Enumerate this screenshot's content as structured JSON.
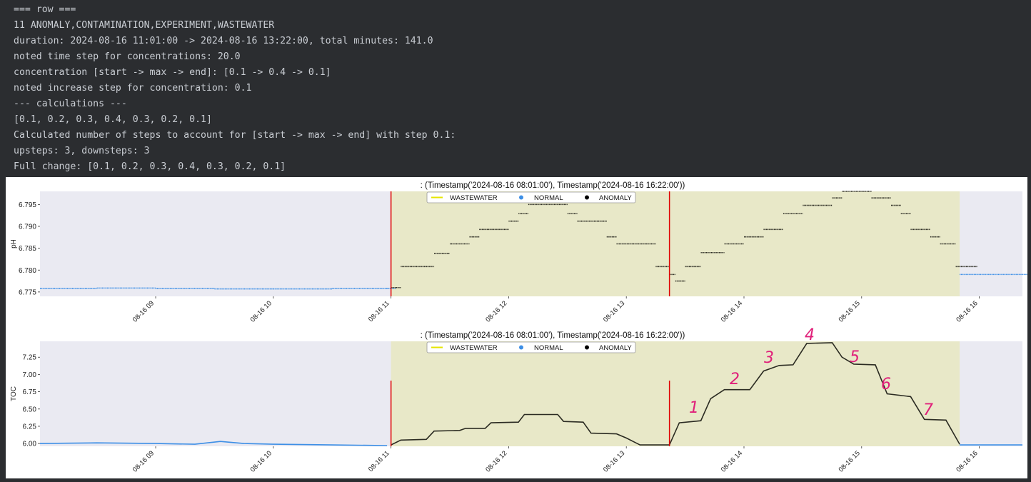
{
  "console": {
    "lines": [
      "=== row ===",
      "11 ANOMALY,CONTAMINATION,EXPERIMENT,WASTEWATER",
      "duration: 2024-08-16 11:01:00 -> 2024-08-16 13:22:00, total minutes: 141.0",
      "noted time step for concentrations: 20.0",
      "concentration [start -> max -> end]: [0.1 -> 0.4 -> 0.1]",
      "noted increase step for concentration: 0.1",
      "--- calculations ---",
      "[0.1, 0.2, 0.3, 0.4, 0.3, 0.2, 0.1]",
      "Calculated number of steps to account for [start -> max -> end] with step 0.1:",
      "upsteps: 3, downsteps: 3",
      "Full change: [0.1, 0.2, 0.3, 0.4, 0.3, 0.2, 0.1]"
    ]
  },
  "colors": {
    "console_bg": "#2b2d30",
    "console_text": "#c9cdd3",
    "plot_bg": "#eaeaf2",
    "wastewater_span": "#e8e8c8",
    "normal": "#3d8fe6",
    "anomaly": "#2b2b22",
    "event_line": "#e00000",
    "annotation": "#e0207a"
  },
  "legend": {
    "wastewater": "WASTEWATER",
    "normal": "NORMAL",
    "anomaly": "ANOMALY"
  },
  "chart_data": [
    {
      "type": "scatter",
      "title": ": (Timestamp('2024-08-16 08:01:00'), Timestamp('2024-08-16 16:22:00'))",
      "xlabel": "",
      "ylabel": "pH",
      "x_ticks": [
        "08-16 09",
        "08-16 10",
        "08-16 11",
        "08-16 12",
        "08-16 13",
        "08-16 14",
        "08-16 15",
        "08-16 16"
      ],
      "y_ticks": [
        "6.775",
        "6.780",
        "6.785",
        "6.790",
        "6.795"
      ],
      "xlim": [
        "2024-08-16 08:01",
        "2024-08-16 16:22"
      ],
      "ylim": [
        6.774,
        6.798
      ],
      "wastewater_span": [
        "2024-08-16 11:00",
        "2024-08-16 15:50"
      ],
      "event_lines": [
        "2024-08-16 11:00",
        "2024-08-16 13:22"
      ],
      "grid": false,
      "legend_position": "top-center",
      "series": [
        {
          "name": "NORMAL",
          "points": [
            [
              "2024-08-16 08:01",
              6.7758
            ],
            [
              "2024-08-16 08:30",
              6.7759
            ],
            [
              "2024-08-16 09:00",
              6.7758
            ],
            [
              "2024-08-16 09:30",
              6.7757
            ],
            [
              "2024-08-16 10:00",
              6.7757
            ],
            [
              "2024-08-16 10:30",
              6.7758
            ],
            [
              "2024-08-16 10:58",
              6.7758
            ],
            [
              "2024-08-16 15:50",
              6.779
            ],
            [
              "2024-08-16 16:05",
              6.779
            ],
            [
              "2024-08-16 16:22",
              6.779
            ]
          ]
        },
        {
          "name": "ANOMALY",
          "points": [
            [
              "2024-08-16 11:00",
              6.776
            ],
            [
              "2024-08-16 11:05",
              6.7808
            ],
            [
              "2024-08-16 11:18",
              6.7808
            ],
            [
              "2024-08-16 11:22",
              6.7838
            ],
            [
              "2024-08-16 11:30",
              6.786
            ],
            [
              "2024-08-16 11:40",
              6.7876
            ],
            [
              "2024-08-16 11:45",
              6.7893
            ],
            [
              "2024-08-16 11:55",
              6.7893
            ],
            [
              "2024-08-16 12:00",
              6.7912
            ],
            [
              "2024-08-16 12:05",
              6.7929
            ],
            [
              "2024-08-16 12:10",
              6.795
            ],
            [
              "2024-08-16 12:25",
              6.795
            ],
            [
              "2024-08-16 12:30",
              6.7929
            ],
            [
              "2024-08-16 12:35",
              6.7912
            ],
            [
              "2024-08-16 12:45",
              6.7912
            ],
            [
              "2024-08-16 12:50",
              6.7876
            ],
            [
              "2024-08-16 12:55",
              6.786
            ],
            [
              "2024-08-16 13:10",
              6.786
            ],
            [
              "2024-08-16 13:15",
              6.7808
            ],
            [
              "2024-08-16 13:22",
              6.779
            ],
            [
              "2024-08-16 13:25",
              6.7775
            ],
            [
              "2024-08-16 13:30",
              6.7808
            ],
            [
              "2024-08-16 13:38",
              6.784
            ],
            [
              "2024-08-16 13:50",
              6.786
            ],
            [
              "2024-08-16 14:00",
              6.7876
            ],
            [
              "2024-08-16 14:10",
              6.7893
            ],
            [
              "2024-08-16 14:20",
              6.7929
            ],
            [
              "2024-08-16 14:30",
              6.7948
            ],
            [
              "2024-08-16 14:45",
              6.7965
            ],
            [
              "2024-08-16 14:50",
              6.798
            ],
            [
              "2024-08-16 15:00",
              6.798
            ],
            [
              "2024-08-16 15:05",
              6.7965
            ],
            [
              "2024-08-16 15:15",
              6.7948
            ],
            [
              "2024-08-16 15:20",
              6.7929
            ],
            [
              "2024-08-16 15:25",
              6.7893
            ],
            [
              "2024-08-16 15:35",
              6.7876
            ],
            [
              "2024-08-16 15:40",
              6.786
            ],
            [
              "2024-08-16 15:48",
              6.7808
            ]
          ]
        }
      ]
    },
    {
      "type": "line",
      "title": ": (Timestamp('2024-08-16 08:01:00'), Timestamp('2024-08-16 16:22:00'))",
      "xlabel": "",
      "ylabel": "TOC",
      "x_ticks": [
        "08-16 09",
        "08-16 10",
        "08-16 11",
        "08-16 12",
        "08-16 13",
        "08-16 14",
        "08-16 15",
        "08-16 16"
      ],
      "y_ticks": [
        "6.00",
        "6.25",
        "6.50",
        "6.75",
        "7.00",
        "7.25"
      ],
      "xlim": [
        "2024-08-16 08:01",
        "2024-08-16 16:22"
      ],
      "ylim": [
        5.96,
        7.48
      ],
      "wastewater_span": [
        "2024-08-16 11:00",
        "2024-08-16 15:50"
      ],
      "event_lines": [
        "2024-08-16 11:00",
        "2024-08-16 13:22"
      ],
      "grid": false,
      "legend_position": "top-center",
      "series": [
        {
          "name": "NORMAL",
          "points": [
            [
              "2024-08-16 08:01",
              6.0
            ],
            [
              "2024-08-16 08:30",
              6.01
            ],
            [
              "2024-08-16 09:00",
              6.0
            ],
            [
              "2024-08-16 09:20",
              5.99
            ],
            [
              "2024-08-16 09:33",
              6.03
            ],
            [
              "2024-08-16 09:45",
              6.0
            ],
            [
              "2024-08-16 10:00",
              5.99
            ],
            [
              "2024-08-16 10:30",
              5.98
            ],
            [
              "2024-08-16 10:58",
              5.97
            ],
            [
              "2024-08-16 15:50",
              5.98
            ],
            [
              "2024-08-16 16:22",
              5.98
            ]
          ]
        },
        {
          "name": "ANOMALY",
          "points": [
            [
              "2024-08-16 11:00",
              5.98
            ],
            [
              "2024-08-16 11:05",
              6.05
            ],
            [
              "2024-08-16 11:18",
              6.06
            ],
            [
              "2024-08-16 11:22",
              6.18
            ],
            [
              "2024-08-16 11:35",
              6.19
            ],
            [
              "2024-08-16 11:38",
              6.22
            ],
            [
              "2024-08-16 11:48",
              6.22
            ],
            [
              "2024-08-16 11:51",
              6.3
            ],
            [
              "2024-08-16 12:05",
              6.31
            ],
            [
              "2024-08-16 12:08",
              6.42
            ],
            [
              "2024-08-16 12:25",
              6.42
            ],
            [
              "2024-08-16 12:28",
              6.32
            ],
            [
              "2024-08-16 12:38",
              6.31
            ],
            [
              "2024-08-16 12:42",
              6.15
            ],
            [
              "2024-08-16 12:55",
              6.14
            ],
            [
              "2024-08-16 13:00",
              6.08
            ],
            [
              "2024-08-16 13:07",
              5.98
            ],
            [
              "2024-08-16 13:22",
              5.98
            ],
            [
              "2024-08-16 13:27",
              6.3
            ],
            [
              "2024-08-16 13:38",
              6.33
            ],
            [
              "2024-08-16 13:43",
              6.65
            ],
            [
              "2024-08-16 13:50",
              6.78
            ],
            [
              "2024-08-16 14:03",
              6.78
            ],
            [
              "2024-08-16 14:10",
              7.05
            ],
            [
              "2024-08-16 14:18",
              7.13
            ],
            [
              "2024-08-16 14:25",
              7.14
            ],
            [
              "2024-08-16 14:32",
              7.45
            ],
            [
              "2024-08-16 14:45",
              7.46
            ],
            [
              "2024-08-16 14:50",
              7.25
            ],
            [
              "2024-08-16 14:56",
              7.15
            ],
            [
              "2024-08-16 15:07",
              7.14
            ],
            [
              "2024-08-16 15:13",
              6.72
            ],
            [
              "2024-08-16 15:25",
              6.68
            ],
            [
              "2024-08-16 15:32",
              6.35
            ],
            [
              "2024-08-16 15:43",
              6.34
            ],
            [
              "2024-08-16 15:50",
              5.99
            ]
          ]
        }
      ],
      "annotations": [
        "1",
        "2",
        "3",
        "4",
        "5",
        "6",
        "7"
      ]
    }
  ]
}
